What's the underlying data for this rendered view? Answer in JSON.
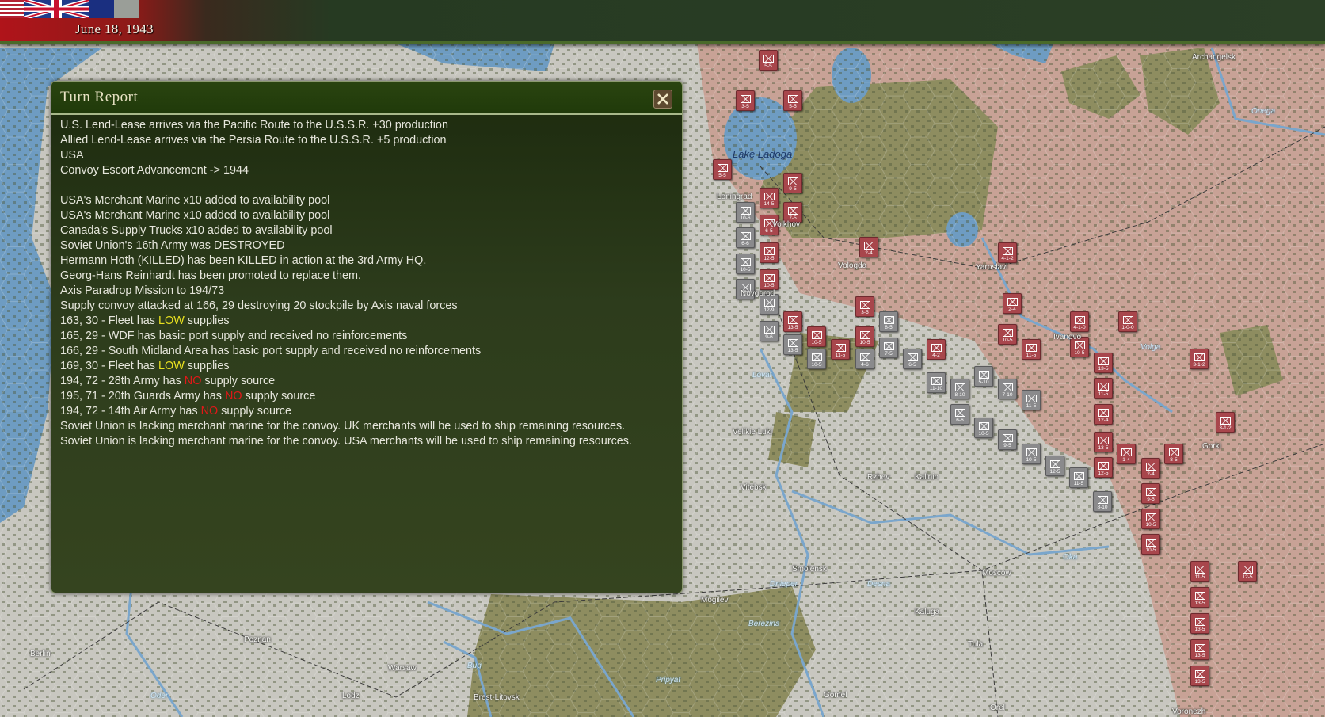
{
  "header": {
    "date": "June 18, 1943",
    "flags": [
      "USA",
      "UK",
      "France"
    ]
  },
  "dialog": {
    "title": "Turn Report",
    "close_icon": "close-x-icon",
    "lines": [
      [
        {
          "t": "U.S. Lend-Lease arrives via the Pacific Route to the U.S.S.R. +30 production"
        }
      ],
      [
        {
          "t": "Allied Lend-Lease arrives via the Persia Route to the U.S.S.R. +5 production"
        }
      ],
      [
        {
          "t": "USA"
        }
      ],
      [
        {
          "t": "Convoy Escort Advancement -> 1944"
        }
      ],
      [
        {
          "t": ""
        }
      ],
      [
        {
          "t": "USA's Merchant Marine x10 added to availability pool"
        }
      ],
      [
        {
          "t": "USA's Merchant Marine x10 added to availability pool"
        }
      ],
      [
        {
          "t": "Canada's Supply Trucks x10 added to availability pool"
        }
      ],
      [
        {
          "t": "Soviet Union's 16th Army was DESTROYED"
        }
      ],
      [
        {
          "t": "Hermann Hoth (KILLED) has been KILLED in action at the 3rd Army HQ."
        }
      ],
      [
        {
          "t": "Georg-Hans Reinhardt has been promoted to replace them."
        }
      ],
      [
        {
          "t": "Axis Paradrop Mission to 194/73"
        }
      ],
      [
        {
          "t": "Supply convoy attacked at 166, 29 destroying 20 stockpile by Axis naval forces"
        }
      ],
      [
        {
          "t": "163, 30 - Fleet has "
        },
        {
          "t": "LOW",
          "c": "low"
        },
        {
          "t": " supplies"
        }
      ],
      [
        {
          "t": "165, 29 - WDF has basic port supply and received no reinforcements"
        }
      ],
      [
        {
          "t": "166, 29 - South Midland Area has basic port supply and received no reinforcements"
        }
      ],
      [
        {
          "t": "169, 30 - Fleet has "
        },
        {
          "t": "LOW",
          "c": "low"
        },
        {
          "t": " supplies"
        }
      ],
      [
        {
          "t": "194, 72 - 28th Army has "
        },
        {
          "t": "NO",
          "c": "no"
        },
        {
          "t": " supply source"
        }
      ],
      [
        {
          "t": "195, 71 - 20th Guards Army has "
        },
        {
          "t": "NO",
          "c": "no"
        },
        {
          "t": " supply source"
        }
      ],
      [
        {
          "t": "194, 72 - 14th Air Army has "
        },
        {
          "t": "NO",
          "c": "no"
        },
        {
          "t": " supply source"
        }
      ],
      [
        {
          "t": "Soviet Union is lacking merchant marine for the convoy. UK merchants will be used to ship remaining resources."
        }
      ],
      [
        {
          "t": "Soviet Union is lacking merchant marine for the convoy. USA merchants will be used to ship remaining resources."
        }
      ]
    ],
    "colors": {
      "low": "#e8e020",
      "no": "#e01818"
    }
  },
  "map": {
    "lake_labels": [
      "Lake Ladoga"
    ],
    "cities": [
      "Leningrad",
      "Volkhov",
      "Novgorod",
      "Vologda",
      "Yaroslavl",
      "Ivanovo",
      "Gorki",
      "Archangelsk",
      "Velikie Luki",
      "Vitebsk",
      "Rzhev",
      "Kalinin",
      "Moscow",
      "Smolensk",
      "Mogilev",
      "Kaluga",
      "Tula",
      "Gomel",
      "Orel",
      "Voronezh",
      "Berlin",
      "Poznan",
      "Warsaw",
      "Lodz",
      "Brest-Litovsk"
    ],
    "rivers": [
      "Onega",
      "Volga",
      "Oka",
      "Lovat",
      "Dnieper",
      "Desna",
      "Berezina",
      "Oder",
      "Bug",
      "Pripyat"
    ],
    "units": [
      {
        "side": "soviet",
        "label": "5-5"
      },
      {
        "side": "soviet",
        "label": "3-5"
      },
      {
        "side": "soviet",
        "label": "5-5"
      },
      {
        "side": "soviet",
        "label": "5-5"
      },
      {
        "side": "soviet",
        "label": "9-5"
      },
      {
        "side": "soviet",
        "label": "14-5"
      },
      {
        "side": "soviet",
        "label": "7-5"
      },
      {
        "side": "soviet",
        "label": "6-5"
      },
      {
        "side": "soviet",
        "label": "12-5"
      },
      {
        "side": "soviet",
        "label": "10-5"
      },
      {
        "side": "soviet",
        "label": "2-4"
      },
      {
        "side": "soviet",
        "label": "4-1-2"
      },
      {
        "side": "soviet",
        "label": "2-4"
      },
      {
        "side": "soviet",
        "label": "13-5"
      },
      {
        "side": "soviet",
        "label": "10-5"
      },
      {
        "side": "soviet",
        "label": "3-5"
      },
      {
        "side": "soviet",
        "label": "10-5"
      },
      {
        "side": "soviet",
        "label": "11-5"
      },
      {
        "side": "soviet",
        "label": "4-2"
      },
      {
        "side": "soviet",
        "label": "10-5"
      },
      {
        "side": "soviet",
        "label": "4-1-0"
      },
      {
        "side": "soviet",
        "label": "1-0-0"
      },
      {
        "side": "soviet",
        "label": "11-5"
      },
      {
        "side": "soviet",
        "label": "10-5"
      },
      {
        "side": "soviet",
        "label": "13-5"
      },
      {
        "side": "soviet",
        "label": "11-5"
      },
      {
        "side": "soviet",
        "label": "12-4"
      },
      {
        "side": "soviet",
        "label": "13-5"
      },
      {
        "side": "soviet",
        "label": "12-5"
      },
      {
        "side": "soviet",
        "label": "1-4"
      },
      {
        "side": "soviet",
        "label": "2-4"
      },
      {
        "side": "soviet",
        "label": "9-5"
      },
      {
        "side": "soviet",
        "label": "10-5"
      },
      {
        "side": "soviet",
        "label": "10-5"
      },
      {
        "side": "soviet",
        "label": "8-5"
      },
      {
        "side": "soviet",
        "label": "11-5"
      },
      {
        "side": "soviet",
        "label": "13-5"
      },
      {
        "side": "soviet",
        "label": "13-5"
      },
      {
        "side": "soviet",
        "label": "13-5"
      },
      {
        "side": "soviet",
        "label": "13-5"
      },
      {
        "side": "soviet",
        "label": "12-5"
      },
      {
        "side": "soviet",
        "label": "3-1-2"
      },
      {
        "side": "soviet",
        "label": "3-1-2"
      },
      {
        "side": "axis",
        "label": "10-6"
      },
      {
        "side": "axis",
        "label": "6-6"
      },
      {
        "side": "axis",
        "label": "10-5"
      },
      {
        "side": "axis",
        "label": "10-5"
      },
      {
        "side": "axis",
        "label": "12-9"
      },
      {
        "side": "axis",
        "label": "9-6"
      },
      {
        "side": "axis",
        "label": "13-5"
      },
      {
        "side": "axis",
        "label": "10-5"
      },
      {
        "side": "axis",
        "label": "4-6"
      },
      {
        "side": "axis",
        "label": "8-5"
      },
      {
        "side": "axis",
        "label": "7-5"
      },
      {
        "side": "axis",
        "label": "6-5"
      },
      {
        "side": "axis",
        "label": "11-10"
      },
      {
        "side": "axis",
        "label": "8-10"
      },
      {
        "side": "axis",
        "label": "5-10"
      },
      {
        "side": "axis",
        "label": "7-10"
      },
      {
        "side": "axis",
        "label": "11-5"
      },
      {
        "side": "axis",
        "label": "6-6"
      },
      {
        "side": "axis",
        "label": "10-5"
      },
      {
        "side": "axis",
        "label": "9-5"
      },
      {
        "side": "axis",
        "label": "10-5"
      },
      {
        "side": "axis",
        "label": "12-5"
      },
      {
        "side": "axis",
        "label": "11-5"
      },
      {
        "side": "axis",
        "label": "8-10"
      }
    ]
  }
}
